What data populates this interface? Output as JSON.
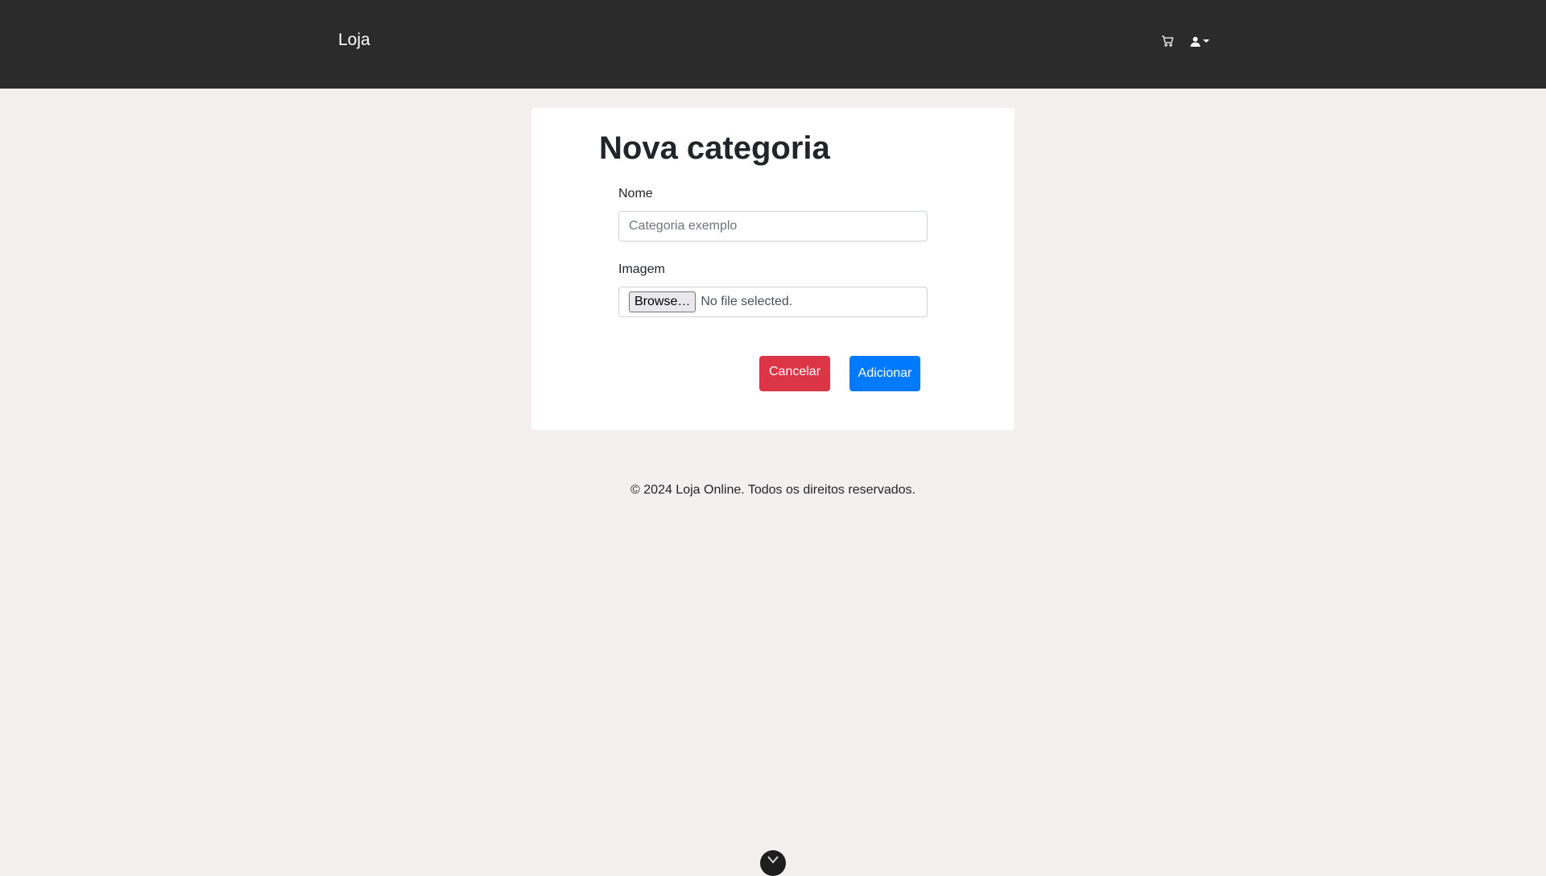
{
  "navbar": {
    "brand": "Loja",
    "cart_icon": "cart-icon",
    "user_icon": "user-icon",
    "caret_icon": "caret-down-icon"
  },
  "form": {
    "title": "Nova categoria",
    "name_label": "Nome",
    "name_placeholder": "Categoria exemplo",
    "name_value": "",
    "image_label": "Imagem",
    "browse_label": "Browse…",
    "file_status": "No file selected.",
    "cancel_label": "Cancelar",
    "submit_label": "Adicionar"
  },
  "footer": {
    "text": "© 2024 Loja Online. Todos os direitos reservados."
  },
  "colors": {
    "navbar_bg": "#2b2b2b",
    "page_bg": "#f5f0f0",
    "cancel": "#dc3545",
    "submit": "#007bff"
  },
  "scroll_button": {
    "icon": "chevron-down-icon"
  }
}
